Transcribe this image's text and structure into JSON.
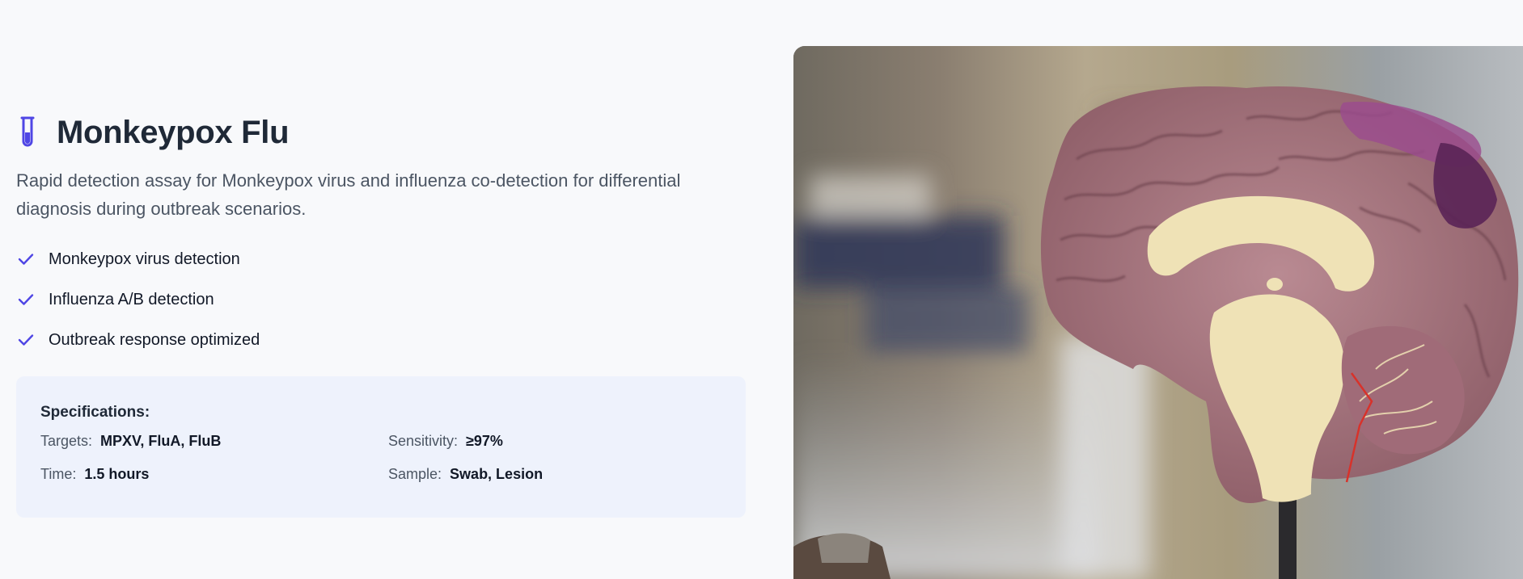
{
  "product": {
    "icon": "test-tube-icon",
    "title": "Monkeypox Flu",
    "description": "Rapid detection assay for Monkeypox virus and influenza co-detection for differential diagnosis during outbreak scenarios."
  },
  "features": [
    {
      "icon": "check-icon",
      "label": "Monkeypox virus detection"
    },
    {
      "icon": "check-icon",
      "label": "Influenza A/B detection"
    },
    {
      "icon": "check-icon",
      "label": "Outbreak response optimized"
    }
  ],
  "specifications": {
    "heading": "Specifications:",
    "targets": {
      "key": "Targets:",
      "value": "MPXV, FluA, FluB"
    },
    "sensitivity": {
      "key": "Sensitivity:",
      "value": "≥97%"
    },
    "time": {
      "key": "Time:",
      "value": "1.5 hours"
    },
    "sample": {
      "key": "Sample:",
      "value": "Swab, Lesion"
    }
  },
  "image": {
    "subject": "brain-model-photo"
  },
  "colors": {
    "accent": "#4f46e5",
    "background": "#f8f9fb",
    "specs_background": "#eef2fc",
    "text_dark": "#1f2937",
    "text_muted": "#4b5563"
  }
}
